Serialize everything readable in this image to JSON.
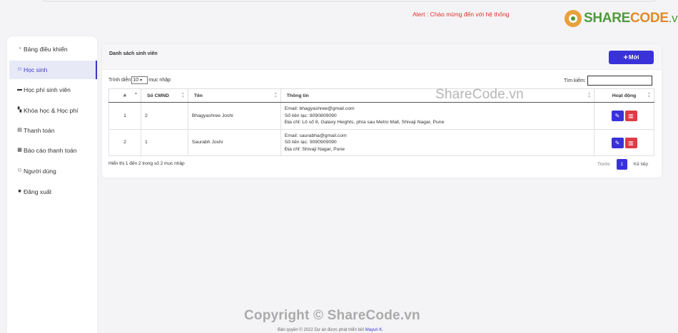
{
  "alert": "Alert : Chào mừng đến với hệ thống",
  "logo": {
    "part1": "SHARE",
    "part2": "CODE",
    "part3": ".vn"
  },
  "sidebar": {
    "items": [
      {
        "label": "Bảng điều khiển",
        "icon": "dashboard-icon",
        "active": false
      },
      {
        "label": "Học sinh",
        "icon": "users-icon",
        "active": true
      },
      {
        "label": "Học phí sinh viên",
        "icon": "money-icon",
        "active": false
      },
      {
        "label": "Khóa học & Học phí",
        "icon": "book-icon",
        "active": false
      },
      {
        "label": "Thanh toán",
        "icon": "document-icon",
        "active": false
      },
      {
        "label": "Báo cáo thanh toán",
        "icon": "table-icon",
        "active": false
      },
      {
        "label": "Người dùng",
        "icon": "users-icon",
        "active": false
      },
      {
        "label": "Đăng xuất",
        "icon": "lock-icon",
        "active": false
      }
    ]
  },
  "card": {
    "title": "Danh sách sinh viên",
    "new_button": "Mới",
    "length": {
      "prefix": "Trình diễn",
      "value": "10",
      "suffix": "mục nhập"
    },
    "search_label": "Tìm kiếm:",
    "columns": [
      "#",
      "Số CMND",
      "Tên",
      "Thông tin",
      "Hoạt động"
    ],
    "rows": [
      {
        "num": "1",
        "cmnd": "2",
        "name": "Bhagyashree Joshi",
        "email": "Email: bhagyashree@gmail.com",
        "phone": "Số liên lạc: 8090809090",
        "address": "Địa chỉ: Lô số 8, Galaxy Heights, phía sau Metro Mall, Shivaji Nagar, Pune"
      },
      {
        "num": "2",
        "cmnd": "1",
        "name": "Saurabh Joshi",
        "email": "Email: saurabha@gmail.com",
        "phone": "Số liên lạc: 9090909090",
        "address": "Địa chỉ: Shivaji Nagar, Pune"
      }
    ],
    "info": "Hiển thị 1 đến 2 trong số 2 mục nhập",
    "pager": {
      "prev": "Trước",
      "page": "1",
      "next": "Kế tiếp"
    }
  },
  "watermark": "ShareCode.vn",
  "copyright_watermark": "Copyright © ShareCode.vn",
  "footer": {
    "text": "Bản quyền © 2022 Dự án được phát triển bởi",
    "author": "Mayuri K."
  }
}
